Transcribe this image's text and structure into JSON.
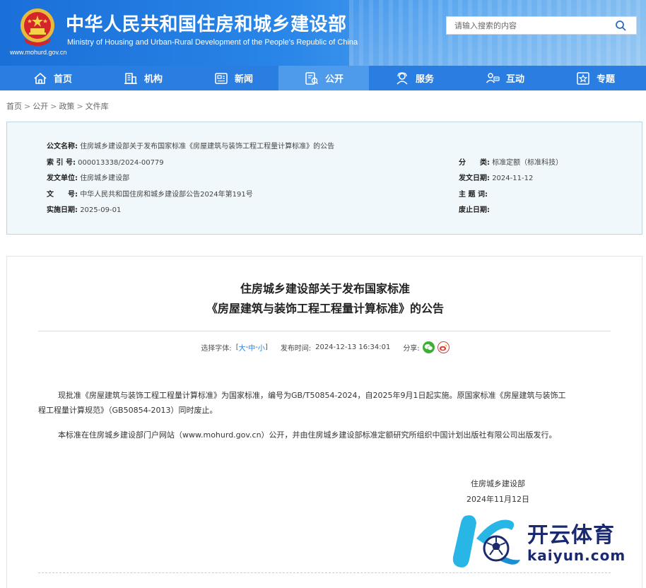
{
  "header": {
    "title_cn": "中华人民共和国住房和城乡建设部",
    "title_en": "Ministry of Housing and Urban-Rural Development of the People's Republic of China",
    "site_url": "www.mohurd.gov.cn",
    "emblem_icon": "national-emblem-icon",
    "search_placeholder": "请输入搜索的内容",
    "search_icon": "search-icon"
  },
  "nav": {
    "items": [
      {
        "label": "首页",
        "icon": "home-icon",
        "active": false
      },
      {
        "label": "机构",
        "icon": "building-icon",
        "active": false
      },
      {
        "label": "新闻",
        "icon": "news-icon",
        "active": false
      },
      {
        "label": "公开",
        "icon": "document-icon",
        "active": true
      },
      {
        "label": "服务",
        "icon": "service-icon",
        "active": false
      },
      {
        "label": "互动",
        "icon": "interaction-icon",
        "active": false
      },
      {
        "label": "专题",
        "icon": "topic-icon",
        "active": false
      }
    ],
    "bg_color": "#2a7de1",
    "active_color": "#4d9bea"
  },
  "breadcrumb": {
    "items": [
      "首页",
      "公开",
      "政策",
      "文件库"
    ],
    "separator": ">"
  },
  "meta": {
    "doc_name_label": "公文名称:",
    "doc_name_value": "住房城乡建设部关于发布国家标准《房屋建筑与装饰工程工程量计算标准》的公告",
    "index_label": "索 引 号:",
    "index_value": "000013338/2024-00779",
    "category_label": "分　　类:",
    "category_value": "标准定额（标准科技）",
    "issuer_label": "发文单位:",
    "issuer_value": "住房城乡建设部",
    "issue_date_label": "发文日期:",
    "issue_date_value": "2024-11-12",
    "doc_no_label": "文　　号:",
    "doc_no_value": "中华人民共和国住房和城乡建设部公告2024年第191号",
    "subject_label": "主 题 词:",
    "subject_value": "",
    "effective_label": "实施日期:",
    "effective_value": "2025-09-01",
    "expiry_label": "废止日期:",
    "expiry_value": ""
  },
  "article": {
    "title_line1": "住房城乡建设部关于发布国家标准",
    "title_line2": "《房屋建筑与装饰工程工程量计算标准》的公告",
    "font_select_label": "选择字体:",
    "font_bracket_open": "[",
    "font_large": "大",
    "font_sep1": "-",
    "font_medium": "中",
    "font_sep2": "-",
    "font_small": "小",
    "font_bracket_close": "]",
    "publish_time_label": "发布时间:",
    "publish_time_value": "2024-12-13 16:34:01",
    "share_label": "分享:",
    "share_icons": [
      "wechat-icon",
      "weibo-icon"
    ],
    "para1_line1": "现批准《房屋建筑与装饰工程工程量计算标准》为国家标准，编号为GB/T50854-2024，自2025年9月1日起实施。原国家标准《房屋建筑与装饰工",
    "para1_line2": "程工程量计算规范》（GB50854-2013）同时废止。",
    "para2": "本标准在住房城乡建设部门户网站（www.mohurd.gov.cn）公开，并由住房城乡建设部标准定额研究所组织中国计划出版社有限公司出版发行。",
    "sign_org": "住房城乡建设部",
    "sign_date": "2024年11月12日"
  },
  "watermark": {
    "text_cn": "开云体育",
    "text_en": "kaiyun.com",
    "logo_icon": "kaiyun-logo-icon"
  }
}
